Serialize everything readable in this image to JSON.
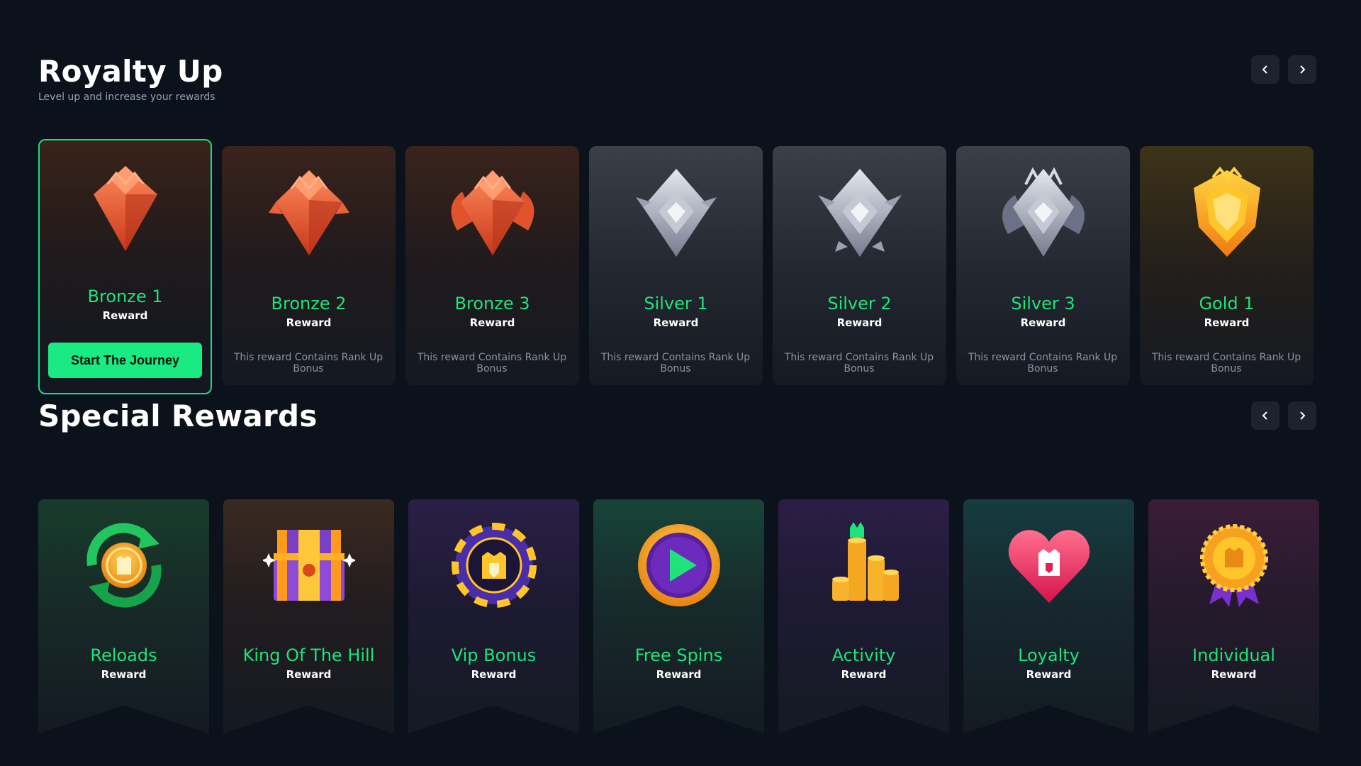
{
  "royalty": {
    "title": "Royalty Up",
    "subtitle": "Level up and increase your rewards",
    "cta_label": "Start The Journey",
    "ranks": [
      {
        "name": "Bronze 1",
        "reward": "Reward",
        "desc": "",
        "tier": "bronze",
        "icon": "bronze-rank-1-icon"
      },
      {
        "name": "Bronze 2",
        "reward": "Reward",
        "desc": "This reward Contains Rank Up Bonus",
        "tier": "bronze",
        "icon": "bronze-rank-2-icon"
      },
      {
        "name": "Bronze 3",
        "reward": "Reward",
        "desc": "This reward Contains Rank Up Bonus",
        "tier": "bronze",
        "icon": "bronze-rank-3-icon"
      },
      {
        "name": "Silver 1",
        "reward": "Reward",
        "desc": "This reward Contains Rank Up Bonus",
        "tier": "silver",
        "icon": "silver-rank-1-icon"
      },
      {
        "name": "Silver 2",
        "reward": "Reward",
        "desc": "This reward Contains Rank Up Bonus",
        "tier": "silver",
        "icon": "silver-rank-2-icon"
      },
      {
        "name": "Silver 3",
        "reward": "Reward",
        "desc": "This reward Contains Rank Up Bonus",
        "tier": "silver",
        "icon": "silver-rank-3-icon"
      },
      {
        "name": "Gold 1",
        "reward": "Reward",
        "desc": "This reward Contains Rank Up Bonus",
        "tier": "gold",
        "icon": "gold-rank-1-icon"
      }
    ]
  },
  "special": {
    "title": "Special Rewards",
    "items": [
      {
        "name": "Reloads",
        "reward": "Reward",
        "icon": "reload-coin-icon"
      },
      {
        "name": "King Of The Hill",
        "reward": "Reward",
        "icon": "treasure-chest-icon"
      },
      {
        "name": "Vip Bonus",
        "reward": "Reward",
        "icon": "vip-chip-icon"
      },
      {
        "name": "Free Spins",
        "reward": "Reward",
        "icon": "play-coin-icon"
      },
      {
        "name": "Activity",
        "reward": "Reward",
        "icon": "coin-stacks-icon"
      },
      {
        "name": "Loyalty",
        "reward": "Reward",
        "icon": "heart-castle-icon"
      },
      {
        "name": "Individual",
        "reward": "Reward",
        "icon": "medal-ribbon-icon"
      }
    ]
  },
  "colors": {
    "background": "#0c121b",
    "accent_green": "#19ea82",
    "rank_name": "#1fe37a",
    "nav_button": "#1c232e"
  }
}
